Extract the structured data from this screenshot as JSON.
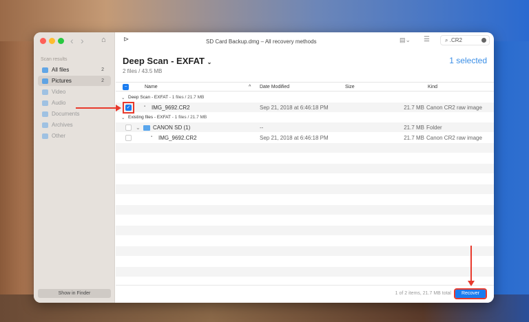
{
  "window": {
    "title": "SD Card Backup.dmg – All recovery methods"
  },
  "search": {
    "value": ".CR2"
  },
  "sidebar": {
    "title": "Scan results",
    "items": [
      {
        "label": "All files",
        "count": "2"
      },
      {
        "label": "Pictures",
        "count": "2"
      },
      {
        "label": "Video"
      },
      {
        "label": "Audio"
      },
      {
        "label": "Documents"
      },
      {
        "label": "Archives"
      },
      {
        "label": "Other"
      }
    ],
    "show_in_finder": "Show in Finder"
  },
  "main": {
    "title": "Deep Scan - EXFAT",
    "subtitle": "2 files / 43.5 MB",
    "selected": "1 selected",
    "columns": [
      "Name",
      "Date Modified",
      "Size",
      "Kind"
    ],
    "groups": [
      {
        "label": "Deep Scan - EXFAT",
        "meta": " - 1 files / 21.7 MB"
      },
      {
        "label": "Existing files - EXFAT",
        "meta": " - 1 files / 21.7 MB"
      }
    ],
    "rows": [
      {
        "name": "IMG_9692.CR2",
        "date": "Sep 21, 2018 at 6:46:18 PM",
        "size": "21.7 MB",
        "kind": "Canon CR2 raw image",
        "checked": true
      },
      {
        "name": "CANON SD (1)",
        "date": "--",
        "size": "21.7 MB",
        "kind": "Folder",
        "checked": false
      },
      {
        "name": "IMG_9692.CR2",
        "date": "Sep 21, 2018 at 6:46:18 PM",
        "size": "21.7 MB",
        "kind": "Canon CR2 raw image",
        "checked": false
      }
    ]
  },
  "footer": {
    "status": "1 of 2 items, 21.7 MB total",
    "recover": "Recover"
  },
  "colors": {
    "accent": "#1a7cf0",
    "annotation": "#e8392c"
  }
}
